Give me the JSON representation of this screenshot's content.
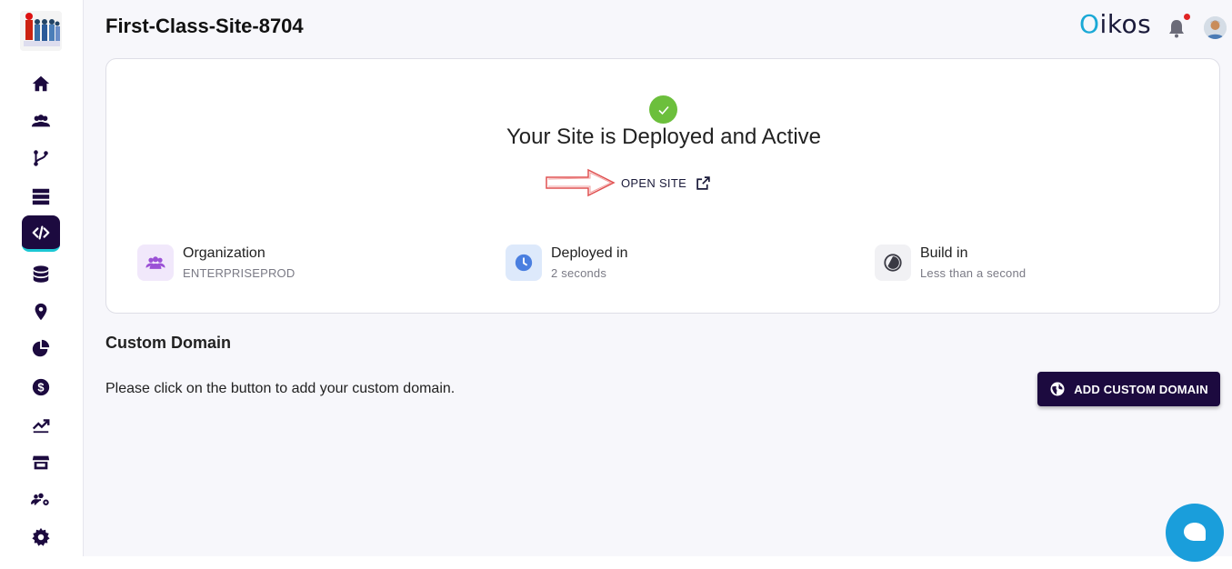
{
  "header": {
    "site_name": "First-Class-Site-8704",
    "brand_first": "O",
    "brand_rest": "ikos"
  },
  "sidebar": {
    "items": [
      {
        "icon": "home-icon"
      },
      {
        "icon": "users-icon"
      },
      {
        "icon": "branch-icon"
      },
      {
        "icon": "server-icon"
      },
      {
        "icon": "code-icon",
        "active": true
      },
      {
        "icon": "database-icon"
      },
      {
        "icon": "location-icon"
      },
      {
        "icon": "pie-chart-icon"
      },
      {
        "icon": "dollar-icon"
      },
      {
        "icon": "trending-icon"
      },
      {
        "icon": "store-icon"
      },
      {
        "icon": "user-settings-icon"
      },
      {
        "icon": "gear-icon"
      }
    ]
  },
  "deployment": {
    "status_title": "Your Site is Deployed and Active",
    "open_site_label": "OPEN SITE",
    "stats": [
      {
        "label": "Organization",
        "value": "ENTERPRISEPROD",
        "icon": "users-icon"
      },
      {
        "label": "Deployed in",
        "value": "2 seconds",
        "icon": "clock-icon"
      },
      {
        "label": "Build in",
        "value": "Less than a second",
        "icon": "half-circle-icon"
      }
    ]
  },
  "custom_domain": {
    "title": "Custom Domain",
    "hint": "Please click on the button to add your custom domain.",
    "button_label": "ADD CUSTOM DOMAIN"
  },
  "colors": {
    "accent": "#1c0a3f",
    "success": "#6cbf3c",
    "chat": "#1a9edb",
    "brand_o": "#1ba9d6"
  }
}
